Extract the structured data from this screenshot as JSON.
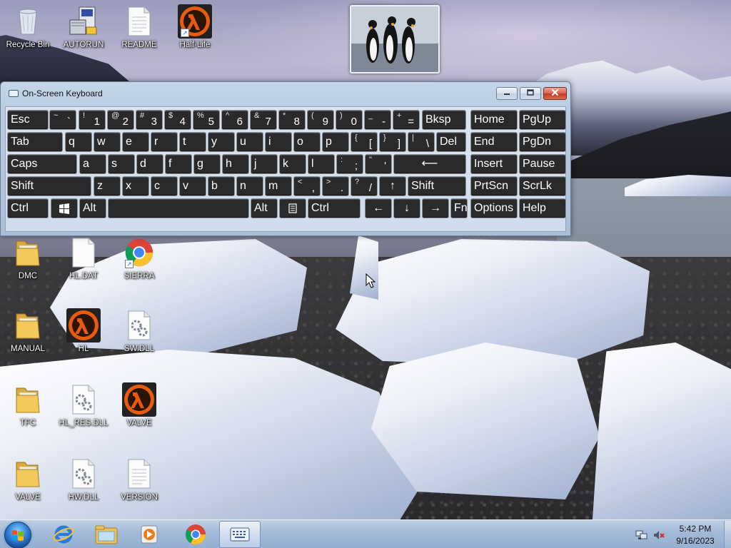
{
  "desktop": {
    "icons": [
      {
        "label": "Recycle Bin",
        "icon": "recycle-bin-icon"
      },
      {
        "label": "AUTORUN",
        "icon": "setup-program-icon"
      },
      {
        "label": "README",
        "icon": "text-document-icon"
      },
      {
        "label": "Half-Life",
        "icon": "half-life-lambda-icon"
      },
      {
        "label": "DMC",
        "icon": "folder-icon"
      },
      {
        "label": "HL.DAT",
        "icon": "blank-file-icon"
      },
      {
        "label": "SIERRA",
        "icon": "chrome-icon"
      },
      {
        "label": "MANUAL",
        "icon": "folder-icon"
      },
      {
        "label": "HL",
        "icon": "half-life-lambda-icon"
      },
      {
        "label": "SW.DLL",
        "icon": "dll-file-icon"
      },
      {
        "label": "TFC",
        "icon": "folder-icon"
      },
      {
        "label": "HL_RES.DLL",
        "icon": "dll-file-icon"
      },
      {
        "label": "VALVE",
        "icon": "half-life-lambda-icon"
      },
      {
        "label": "VALVE",
        "icon": "folder-icon"
      },
      {
        "label": "HW.DLL",
        "icon": "dll-file-icon"
      },
      {
        "label": "VERSION",
        "icon": "text-document-icon"
      }
    ]
  },
  "osk": {
    "title": "On-Screen Keyboard",
    "controls": {
      "minimize": "minimize-icon",
      "maximize": "maximize-icon",
      "close": "close-icon"
    },
    "rows": [
      [
        {
          "main": "Esc"
        },
        {
          "sec": "~",
          "pri": "`"
        },
        {
          "sec": "!",
          "pri": "1"
        },
        {
          "sec": "@",
          "pri": "2"
        },
        {
          "sec": "#",
          "pri": "3"
        },
        {
          "sec": "$",
          "pri": "4"
        },
        {
          "sec": "%",
          "pri": "5"
        },
        {
          "sec": "^",
          "pri": "6"
        },
        {
          "sec": "&",
          "pri": "7"
        },
        {
          "sec": "*",
          "pri": "8"
        },
        {
          "sec": "(",
          "pri": "9"
        },
        {
          "sec": ")",
          "pri": "0"
        },
        {
          "sec": "_",
          "pri": "-"
        },
        {
          "sec": "+",
          "pri": "="
        },
        {
          "main": "Bksp"
        },
        {
          "main": "Home"
        },
        {
          "main": "PgUp"
        }
      ],
      [
        {
          "main": "Tab"
        },
        {
          "main": "q"
        },
        {
          "main": "w"
        },
        {
          "main": "e"
        },
        {
          "main": "r"
        },
        {
          "main": "t"
        },
        {
          "main": "y"
        },
        {
          "main": "u"
        },
        {
          "main": "i"
        },
        {
          "main": "o"
        },
        {
          "main": "p"
        },
        {
          "sec": "{",
          "pri": "["
        },
        {
          "sec": "}",
          "pri": "]"
        },
        {
          "sec": "|",
          "pri": "\\"
        },
        {
          "main": "Del"
        },
        {
          "main": "End"
        },
        {
          "main": "PgDn"
        }
      ],
      [
        {
          "main": "Caps"
        },
        {
          "main": "a"
        },
        {
          "main": "s"
        },
        {
          "main": "d"
        },
        {
          "main": "f"
        },
        {
          "main": "g"
        },
        {
          "main": "h"
        },
        {
          "main": "j"
        },
        {
          "main": "k"
        },
        {
          "main": "l"
        },
        {
          "sec": ":",
          "pri": ";"
        },
        {
          "sec": "\"",
          "pri": "'"
        },
        {
          "main": "⟵"
        },
        {
          "main": "Insert"
        },
        {
          "main": "Pause"
        }
      ],
      [
        {
          "main": "Shift"
        },
        {
          "main": "z"
        },
        {
          "main": "x"
        },
        {
          "main": "c"
        },
        {
          "main": "v"
        },
        {
          "main": "b"
        },
        {
          "main": "n"
        },
        {
          "main": "m"
        },
        {
          "sec": "<",
          "pri": ","
        },
        {
          "sec": ">",
          "pri": "."
        },
        {
          "sec": "?",
          "pri": "/"
        },
        {
          "main": "↑"
        },
        {
          "main": "Shift"
        },
        {
          "main": "PrtScn"
        },
        {
          "main": "ScrLk"
        }
      ],
      [
        {
          "main": "Ctrl"
        },
        {
          "main": "",
          "icon": "windows-logo-icon"
        },
        {
          "main": "Alt"
        },
        {
          "main": ""
        },
        {
          "main": "Alt"
        },
        {
          "main": "",
          "icon": "menu-key-icon"
        },
        {
          "main": "Ctrl"
        },
        {
          "main": "←"
        },
        {
          "main": "↓"
        },
        {
          "main": "→"
        },
        {
          "main": "Fn"
        },
        {
          "main": "Options"
        },
        {
          "main": "Help"
        }
      ]
    ]
  },
  "taskbar": {
    "start": "windows-start-orb-icon",
    "pinned": [
      "internet-explorer-icon",
      "file-explorer-icon",
      "media-player-icon",
      "chrome-icon",
      "on-screen-keyboard-icon"
    ],
    "tray": {
      "network": "network-icon",
      "volume": "volume-muted-icon"
    },
    "clock": {
      "time": "5:42 PM",
      "date": "9/16/2023"
    }
  },
  "colors": {
    "taskbar": "#a8bfdc",
    "key_face": "#2a2a2d",
    "close_button": "#c94a32"
  }
}
